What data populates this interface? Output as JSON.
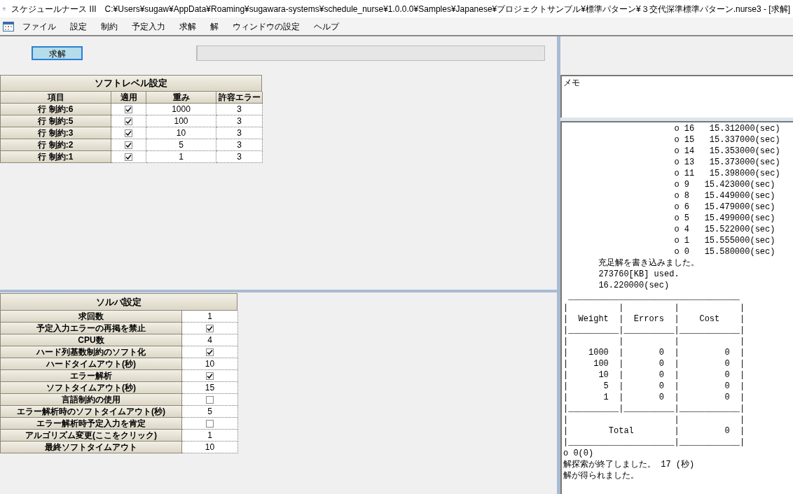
{
  "window": {
    "title": "スケジュールナース III　C:¥Users¥sugaw¥AppData¥Roaming¥sugawara-systems¥schedule_nurse¥1.0.0.0¥Samples¥Japanese¥プロジェクトサンプル¥標準パターン¥３交代深準標準パターン.nurse3 - [求解]"
  },
  "menu": [
    "ファイル",
    "設定",
    "制約",
    "予定入力",
    "求解",
    "解",
    "ウィンドウの設定",
    "ヘルプ"
  ],
  "toolbar": {
    "solve_button": "求解",
    "progress": {
      "level": 0
    }
  },
  "soft_level": {
    "title": "ソフトレベル設定",
    "columns": [
      "項目",
      "適用",
      "重み",
      "許容エラー"
    ],
    "rows": [
      {
        "item": "行 制約:6",
        "applied": true,
        "weight": "1000",
        "allowed_error": "3"
      },
      {
        "item": "行 制約:5",
        "applied": true,
        "weight": "100",
        "allowed_error": "3"
      },
      {
        "item": "行 制約:3",
        "applied": true,
        "weight": "10",
        "allowed_error": "3"
      },
      {
        "item": "行 制約:2",
        "applied": true,
        "weight": "5",
        "allowed_error": "3"
      },
      {
        "item": "行 制約:1",
        "applied": true,
        "weight": "1",
        "allowed_error": "3"
      }
    ]
  },
  "solver": {
    "title": "ソルバ設定",
    "rows": [
      {
        "label": "求回数",
        "kind": "text",
        "value": "1"
      },
      {
        "label": "予定入力エラーの再掲を禁止",
        "kind": "check",
        "checked": true
      },
      {
        "label": "CPU数",
        "kind": "text",
        "value": "4"
      },
      {
        "label": "ハード列基数制約のソフト化",
        "kind": "check",
        "checked": true
      },
      {
        "label": "ハードタイムアウト(秒)",
        "kind": "text",
        "value": "10"
      },
      {
        "label": "エラー解析",
        "kind": "check",
        "checked": true
      },
      {
        "label": "ソフトタイムアウト(秒)",
        "kind": "text",
        "value": "15"
      },
      {
        "label": "言語制約の使用",
        "kind": "check",
        "checked": false
      },
      {
        "label": "エラー解析時のソフトタイムアウト(秒)",
        "kind": "text",
        "value": "5"
      },
      {
        "label": "エラー解析時予定入力を肯定",
        "kind": "check",
        "checked": false
      },
      {
        "label": "アルゴリズム変更(ここをクリック)",
        "kind": "text",
        "value": "1"
      },
      {
        "label": "最終ソフトタイムアウト",
        "kind": "text",
        "value": "10"
      }
    ]
  },
  "memo": {
    "label": "メモ"
  },
  "log": [
    "                      o 16   15.312000(sec)",
    "                      o 15   15.337000(sec)",
    "                      o 14   15.353000(sec)",
    "                      o 13   15.373000(sec)",
    "                      o 11   15.398000(sec)",
    "                      o 9   15.423000(sec)",
    "                      o 8   15.449000(sec)",
    "                      o 6   15.479000(sec)",
    "                      o 5   15.499000(sec)",
    "                      o 4   15.522000(sec)",
    "                      o 1   15.555000(sec)",
    "                      o 0   15.580000(sec)",
    "       充足解を書き込みました。",
    "       273760[KB] used.",
    "       16.220000(sec)",
    " __________________________________",
    "|          |          |            |",
    "|  Weight  |  Errors  |    Cost    |",
    "|__________|__________|____________|",
    "|          |          |            |",
    "|    1000  |       0  |         0  |",
    "|     100  |       0  |         0  |",
    "|      10  |       0  |         0  |",
    "|       5  |       0  |         0  |",
    "|       1  |       0  |         0  |",
    "|__________|__________|____________|",
    "|                     |            |",
    "|        Total        |         0  |",
    "|_____________________|____________|",
    "o 0(0)",
    "解探索が終了しました。 17 (秒)",
    "解が得られました。"
  ]
}
